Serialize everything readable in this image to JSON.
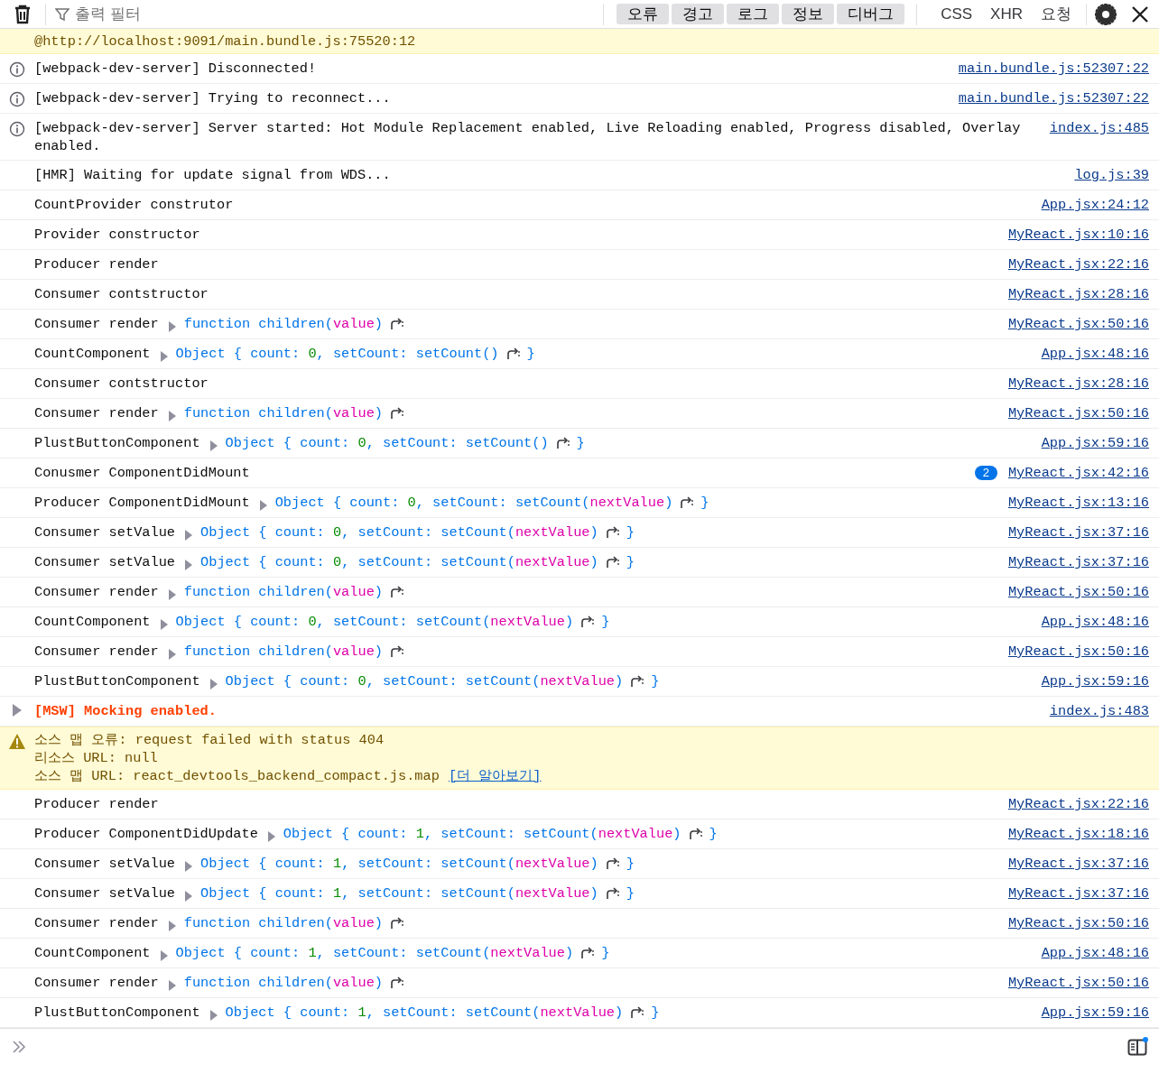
{
  "toolbar": {
    "filter": {
      "placeholder": "출력 필터"
    },
    "levels": [
      {
        "label": "오류",
        "selected": true
      },
      {
        "label": "경고",
        "selected": true
      },
      {
        "label": "로그",
        "selected": true
      },
      {
        "label": "정보",
        "selected": true
      },
      {
        "label": "디버그",
        "selected": true
      }
    ],
    "categories": [
      {
        "label": "CSS",
        "selected": false
      },
      {
        "label": "XHR",
        "selected": false
      },
      {
        "label": "요청",
        "selected": false
      }
    ]
  },
  "messages": [
    {
      "kind": "trace",
      "text": "@http://localhost:9091/main.bundle.js:75520:12"
    },
    {
      "kind": "info",
      "text": "[webpack-dev-server] Disconnected!",
      "source": "main.bundle.js:52307:22"
    },
    {
      "kind": "info",
      "text": "[webpack-dev-server] Trying to reconnect...",
      "source": "main.bundle.js:52307:22"
    },
    {
      "kind": "info",
      "text": "[webpack-dev-server] Server started: Hot Module Replacement enabled, Live Reloading enabled, Progress disabled, Overlay enabled.",
      "source": "index.js:485"
    },
    {
      "kind": "log",
      "text": "[HMR] Waiting for update signal from WDS...",
      "source": "log.js:39"
    },
    {
      "kind": "log",
      "text": "CountProvider construtor",
      "source": "App.jsx:24:12"
    },
    {
      "kind": "log",
      "text": "Provider constructor",
      "source": "MyReact.jsx:10:16"
    },
    {
      "kind": "log",
      "text": "Producer render",
      "source": "MyReact.jsx:22:16"
    },
    {
      "kind": "log",
      "text": "Consumer contstructor",
      "source": "MyReact.jsx:28:16"
    },
    {
      "kind": "log",
      "text": "Consumer render",
      "source": "MyReact.jsx:50:16",
      "preview": [
        {
          "kind": "text",
          "parts": [
            {
              "text": "function children(",
              "kind": "fn"
            },
            {
              "text": "value",
              "kind": "param"
            },
            {
              "text": ")",
              "kind": "fn"
            }
          ]
        },
        {
          "kind": "jump"
        }
      ]
    },
    {
      "kind": "log",
      "text": "CountComponent",
      "source": "App.jsx:48:16",
      "preview": [
        {
          "kind": "text",
          "parts": [
            {
              "text": "Object { count: ",
              "kind": "fn"
            },
            {
              "text": "0",
              "kind": "number"
            },
            {
              "text": ", setCount: setCount()",
              "kind": "fn"
            }
          ]
        },
        {
          "kind": "jump"
        },
        {
          "kind": "text",
          "parts": [
            {
              "text": "}",
              "kind": "fn"
            }
          ]
        }
      ]
    },
    {
      "kind": "log",
      "text": "Consumer contstructor",
      "source": "MyReact.jsx:28:16"
    },
    {
      "kind": "log",
      "text": "Consumer render",
      "source": "MyReact.jsx:50:16",
      "preview": [
        {
          "kind": "text",
          "parts": [
            {
              "text": "function children(",
              "kind": "fn"
            },
            {
              "text": "value",
              "kind": "param"
            },
            {
              "text": ")",
              "kind": "fn"
            }
          ]
        },
        {
          "kind": "jump"
        }
      ]
    },
    {
      "kind": "log",
      "text": "PlustButtonComponent",
      "source": "App.jsx:59:16",
      "preview": [
        {
          "kind": "text",
          "parts": [
            {
              "text": "Object { count: ",
              "kind": "fn"
            },
            {
              "text": "0",
              "kind": "number"
            },
            {
              "text": ", setCount: setCount()",
              "kind": "fn"
            }
          ]
        },
        {
          "kind": "jump"
        },
        {
          "kind": "text",
          "parts": [
            {
              "text": "}",
              "kind": "fn"
            }
          ]
        }
      ]
    },
    {
      "kind": "log",
      "text": "Conusmer ComponentDidMount",
      "source": "MyReact.jsx:42:16",
      "count": "2"
    },
    {
      "kind": "log",
      "text": "Producer ComponentDidMount",
      "source": "MyReact.jsx:13:16",
      "preview": [
        {
          "kind": "text",
          "parts": [
            {
              "text": "Object { count: ",
              "kind": "fn"
            },
            {
              "text": "0",
              "kind": "number"
            },
            {
              "text": ", setCount: setCount(",
              "kind": "fn"
            },
            {
              "text": "nextValue",
              "kind": "param"
            },
            {
              "text": ")",
              "kind": "fn"
            }
          ]
        },
        {
          "kind": "jump"
        },
        {
          "kind": "text",
          "parts": [
            {
              "text": "}",
              "kind": "fn"
            }
          ]
        }
      ]
    },
    {
      "kind": "log",
      "text": "Consumer setValue",
      "source": "MyReact.jsx:37:16",
      "preview": [
        {
          "kind": "text",
          "parts": [
            {
              "text": "Object { count: ",
              "kind": "fn"
            },
            {
              "text": "0",
              "kind": "number"
            },
            {
              "text": ", setCount: setCount(",
              "kind": "fn"
            },
            {
              "text": "nextValue",
              "kind": "param"
            },
            {
              "text": ")",
              "kind": "fn"
            }
          ]
        },
        {
          "kind": "jump"
        },
        {
          "kind": "text",
          "parts": [
            {
              "text": "}",
              "kind": "fn"
            }
          ]
        }
      ]
    },
    {
      "kind": "log",
      "text": "Consumer setValue",
      "source": "MyReact.jsx:37:16",
      "preview": [
        {
          "kind": "text",
          "parts": [
            {
              "text": "Object { count: ",
              "kind": "fn"
            },
            {
              "text": "0",
              "kind": "number"
            },
            {
              "text": ", setCount: setCount(",
              "kind": "fn"
            },
            {
              "text": "nextValue",
              "kind": "param"
            },
            {
              "text": ")",
              "kind": "fn"
            }
          ]
        },
        {
          "kind": "jump"
        },
        {
          "kind": "text",
          "parts": [
            {
              "text": "}",
              "kind": "fn"
            }
          ]
        }
      ]
    },
    {
      "kind": "log",
      "text": "Consumer render",
      "source": "MyReact.jsx:50:16",
      "preview": [
        {
          "kind": "text",
          "parts": [
            {
              "text": "function children(",
              "kind": "fn"
            },
            {
              "text": "value",
              "kind": "param"
            },
            {
              "text": ")",
              "kind": "fn"
            }
          ]
        },
        {
          "kind": "jump"
        }
      ]
    },
    {
      "kind": "log",
      "text": "CountComponent",
      "source": "App.jsx:48:16",
      "preview": [
        {
          "kind": "text",
          "parts": [
            {
              "text": "Object { count: ",
              "kind": "fn"
            },
            {
              "text": "0",
              "kind": "number"
            },
            {
              "text": ", setCount: setCount(",
              "kind": "fn"
            },
            {
              "text": "nextValue",
              "kind": "param"
            },
            {
              "text": ")",
              "kind": "fn"
            }
          ]
        },
        {
          "kind": "jump"
        },
        {
          "kind": "text",
          "parts": [
            {
              "text": "}",
              "kind": "fn"
            }
          ]
        }
      ]
    },
    {
      "kind": "log",
      "text": "Consumer render",
      "source": "MyReact.jsx:50:16",
      "preview": [
        {
          "kind": "text",
          "parts": [
            {
              "text": "function children(",
              "kind": "fn"
            },
            {
              "text": "value",
              "kind": "param"
            },
            {
              "text": ")",
              "kind": "fn"
            }
          ]
        },
        {
          "kind": "jump"
        }
      ]
    },
    {
      "kind": "log",
      "text": "PlustButtonComponent",
      "source": "App.jsx:59:16",
      "preview": [
        {
          "kind": "text",
          "parts": [
            {
              "text": "Object { count: ",
              "kind": "fn"
            },
            {
              "text": "0",
              "kind": "number"
            },
            {
              "text": ", setCount: setCount(",
              "kind": "fn"
            },
            {
              "text": "nextValue",
              "kind": "param"
            },
            {
              "text": ")",
              "kind": "fn"
            }
          ]
        },
        {
          "kind": "jump"
        },
        {
          "kind": "text",
          "parts": [
            {
              "text": "}",
              "kind": "fn"
            }
          ]
        }
      ]
    },
    {
      "kind": "group",
      "text": "[MSW] Mocking enabled.",
      "source": "index.js:483",
      "expanded": false
    },
    {
      "kind": "warning",
      "lines": [
        "소스 맵 오류: request failed with status 404",
        "리소스 URL: null",
        "소스 맵 URL: react_devtools_backend_compact.js.map"
      ],
      "link": "[더 알아보기]"
    },
    {
      "kind": "log",
      "text": "Producer render",
      "source": "MyReact.jsx:22:16"
    },
    {
      "kind": "log",
      "text": "Producer ComponentDidUpdate",
      "source": "MyReact.jsx:18:16",
      "preview": [
        {
          "kind": "text",
          "parts": [
            {
              "text": "Object { count: ",
              "kind": "fn"
            },
            {
              "text": "1",
              "kind": "number"
            },
            {
              "text": ", setCount: setCount(",
              "kind": "fn"
            },
            {
              "text": "nextValue",
              "kind": "param"
            },
            {
              "text": ")",
              "kind": "fn"
            }
          ]
        },
        {
          "kind": "jump"
        },
        {
          "kind": "text",
          "parts": [
            {
              "text": "}",
              "kind": "fn"
            }
          ]
        }
      ]
    },
    {
      "kind": "log",
      "text": "Consumer setValue",
      "source": "MyReact.jsx:37:16",
      "preview": [
        {
          "kind": "text",
          "parts": [
            {
              "text": "Object { count: ",
              "kind": "fn"
            },
            {
              "text": "1",
              "kind": "number"
            },
            {
              "text": ", setCount: setCount(",
              "kind": "fn"
            },
            {
              "text": "nextValue",
              "kind": "param"
            },
            {
              "text": ")",
              "kind": "fn"
            }
          ]
        },
        {
          "kind": "jump"
        },
        {
          "kind": "text",
          "parts": [
            {
              "text": "}",
              "kind": "fn"
            }
          ]
        }
      ]
    },
    {
      "kind": "log",
      "text": "Consumer setValue",
      "source": "MyReact.jsx:37:16",
      "preview": [
        {
          "kind": "text",
          "parts": [
            {
              "text": "Object { count: ",
              "kind": "fn"
            },
            {
              "text": "1",
              "kind": "number"
            },
            {
              "text": ", setCount: setCount(",
              "kind": "fn"
            },
            {
              "text": "nextValue",
              "kind": "param"
            },
            {
              "text": ")",
              "kind": "fn"
            }
          ]
        },
        {
          "kind": "jump"
        },
        {
          "kind": "text",
          "parts": [
            {
              "text": "}",
              "kind": "fn"
            }
          ]
        }
      ]
    },
    {
      "kind": "log",
      "text": "Consumer render",
      "source": "MyReact.jsx:50:16",
      "preview": [
        {
          "kind": "text",
          "parts": [
            {
              "text": "function children(",
              "kind": "fn"
            },
            {
              "text": "value",
              "kind": "param"
            },
            {
              "text": ")",
              "kind": "fn"
            }
          ]
        },
        {
          "kind": "jump"
        }
      ]
    },
    {
      "kind": "log",
      "text": "CountComponent",
      "source": "App.jsx:48:16",
      "preview": [
        {
          "kind": "text",
          "parts": [
            {
              "text": "Object { count: ",
              "kind": "fn"
            },
            {
              "text": "1",
              "kind": "number"
            },
            {
              "text": ", setCount: setCount(",
              "kind": "fn"
            },
            {
              "text": "nextValue",
              "kind": "param"
            },
            {
              "text": ")",
              "kind": "fn"
            }
          ]
        },
        {
          "kind": "jump"
        },
        {
          "kind": "text",
          "parts": [
            {
              "text": "}",
              "kind": "fn"
            }
          ]
        }
      ]
    },
    {
      "kind": "log",
      "text": "Consumer render",
      "source": "MyReact.jsx:50:16",
      "preview": [
        {
          "kind": "text",
          "parts": [
            {
              "text": "function children(",
              "kind": "fn"
            },
            {
              "text": "value",
              "kind": "param"
            },
            {
              "text": ")",
              "kind": "fn"
            }
          ]
        },
        {
          "kind": "jump"
        }
      ]
    },
    {
      "kind": "log",
      "text": "PlustButtonComponent",
      "source": "App.jsx:59:16",
      "preview": [
        {
          "kind": "text",
          "parts": [
            {
              "text": "Object { count: ",
              "kind": "fn"
            },
            {
              "text": "1",
              "kind": "number"
            },
            {
              "text": ", setCount: setCount(",
              "kind": "fn"
            },
            {
              "text": "nextValue",
              "kind": "param"
            },
            {
              "text": ")",
              "kind": "fn"
            }
          ]
        },
        {
          "kind": "jump"
        },
        {
          "kind": "text",
          "parts": [
            {
              "text": "}",
              "kind": "fn"
            }
          ]
        }
      ]
    }
  ]
}
